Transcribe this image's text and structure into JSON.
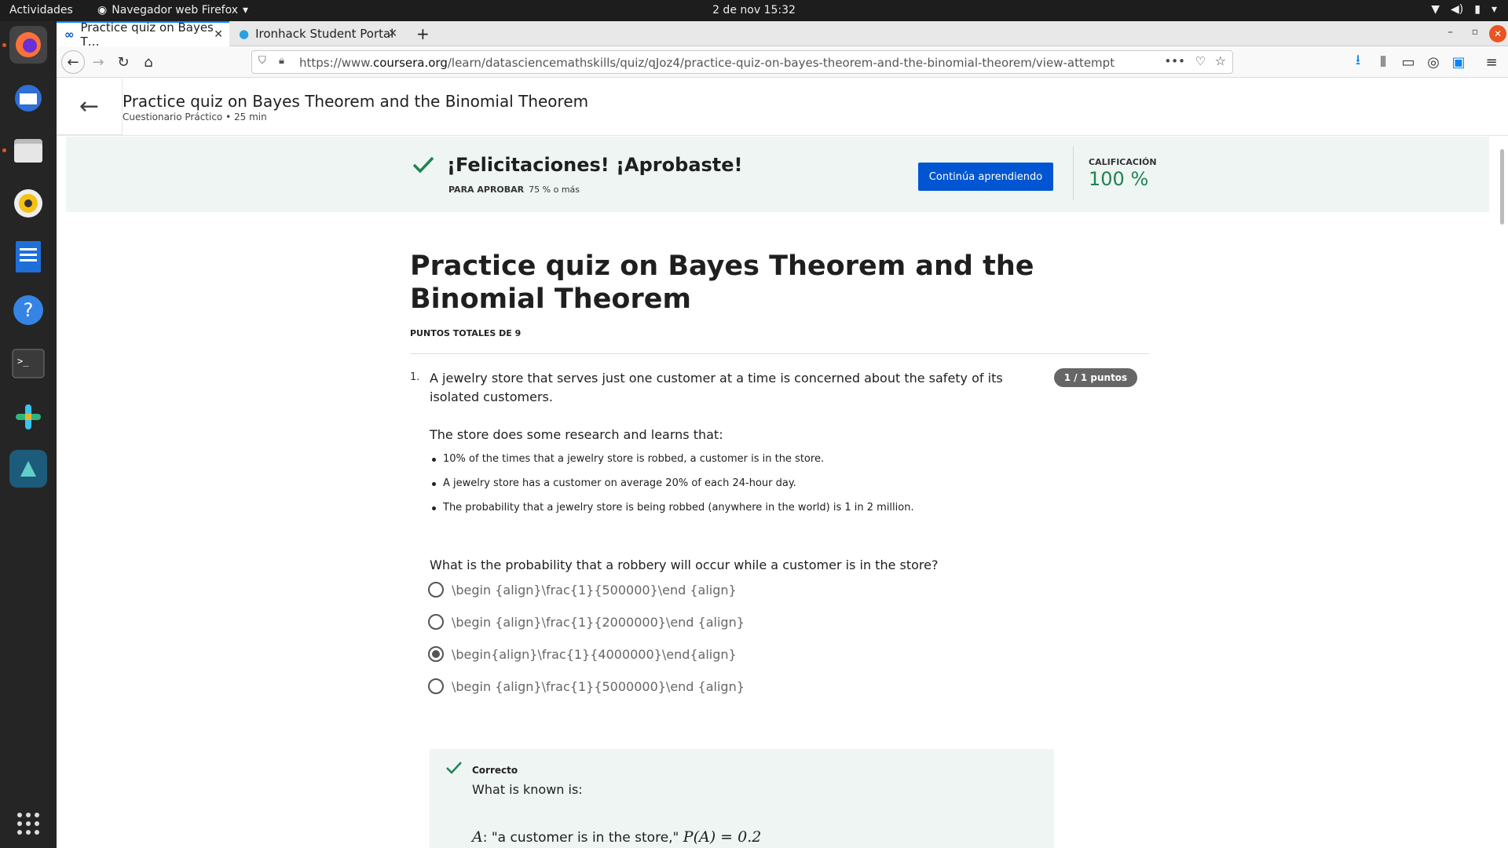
{
  "topbar": {
    "activities": "Actividades",
    "app_name": "Navegador web Firefox",
    "clock": "2 de nov  15:32"
  },
  "browser": {
    "tabs": [
      {
        "label": "Practice quiz on Bayes T…"
      },
      {
        "label": "Ironhack Student Portal"
      }
    ],
    "url_prefix": "https://www.",
    "url_domain": "coursera.org",
    "url_path": "/learn/datasciencemathskills/quiz/qJoz4/practice-quiz-on-bayes-theorem-and-the-binomial-theorem/view-attempt"
  },
  "header": {
    "title": "Practice quiz on Bayes Theorem and the Binomial Theorem",
    "subtitle": "Cuestionario Práctico • 25 min"
  },
  "banner": {
    "congrats": "¡Felicitaciones! ¡Aprobaste!",
    "pass_label": "PARA APROBAR",
    "pass_value": "75 % o más",
    "continue_label": "Continúa aprendiendo",
    "grade_label": "CALIFICACIÓN",
    "grade_value": "100 %"
  },
  "quiz": {
    "title": "Practice quiz on Bayes Theorem and the Binomial Theorem",
    "points_total": "PUNTOS TOTALES DE 9",
    "question": {
      "number": "1.",
      "text": "A jewelry store that serves just one customer at a time is concerned about the safety of its isolated customers.",
      "badge": "1 / 1 puntos",
      "intro": "The store does some research and learns that:",
      "facts": [
        "10% of the times that a jewelry store is robbed, a customer is in the store.",
        "A jewelry store has a customer on average 20% of each 24-hour day.",
        "The probability that a jewelry store is being robbed (anywhere in the world) is 1 in 2 million."
      ],
      "ask": "What is the probability that a robbery will occur while a customer is in the store?",
      "options": [
        {
          "label": "\\begin {align}\\frac{1}{500000}\\end {align}",
          "selected": false
        },
        {
          "label": "\\begin {align}\\frac{1}{2000000}\\end {align}",
          "selected": false
        },
        {
          "label": "\\begin{align}\\frac{1}{4000000}\\end{align}",
          "selected": true
        },
        {
          "label": "\\begin {align}\\frac{1}{5000000}\\end {align}",
          "selected": false
        }
      ]
    },
    "feedback": {
      "status": "Correcto",
      "text": "What is known is:",
      "formula_var": "A",
      "formula_text": ": \"a customer is in the store,\" ",
      "formula_math": "P(A) = 0.2"
    }
  },
  "colors": {
    "accent": "#0056d2",
    "success": "#1f8354",
    "banner_bg": "#eef5f2"
  }
}
